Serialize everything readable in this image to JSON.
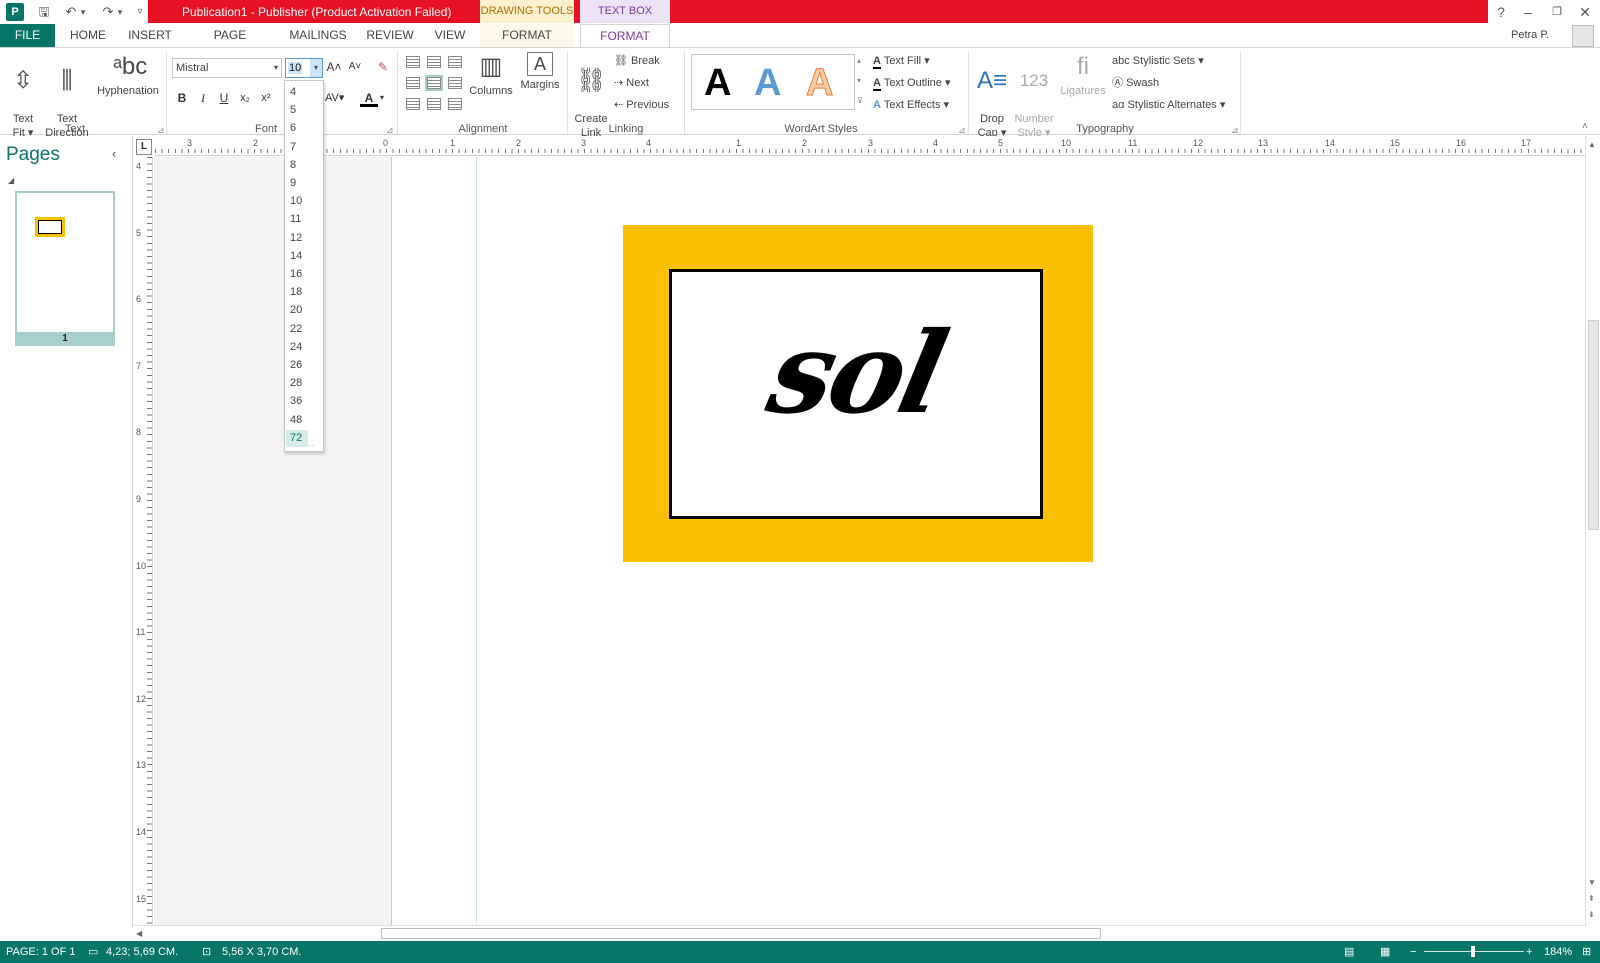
{
  "window": {
    "title": "Publication1 -  Publisher (Product Activation Failed)",
    "context_tabs": {
      "drawing": "DRAWING TOOLS",
      "textbox": "TEXT BOX TOOLS"
    },
    "help": "?",
    "minimize": "–",
    "restore": "❐",
    "close": "✕",
    "user": "Petra P.",
    "accent": "#077568",
    "titlebar_color": "#e81123"
  },
  "qat": {
    "logo": "P",
    "save": "🖫",
    "undo": "↶",
    "undo_drop": "▾",
    "redo": "↷",
    "redo_drop": "▾",
    "customize": "▿"
  },
  "tabs": {
    "file": "FILE",
    "home": "HOME",
    "insert": "INSERT",
    "page_design": "PAGE DESIGN",
    "mailings": "MAILINGS",
    "review": "REVIEW",
    "view": "VIEW",
    "format_drawing": "FORMAT",
    "format_textbox": "FORMAT"
  },
  "ribbon": {
    "text_group": {
      "label": "Text",
      "text_fit": "Text\nFit ▾",
      "text_direction": "Text\nDirection",
      "hyphenation": "Hyphenation"
    },
    "font_group": {
      "label": "Font",
      "font_name": "Mistral",
      "font_size": "10",
      "bold": "B",
      "italic": "I",
      "underline": "U",
      "subscript": "x₂",
      "superscript": "x²",
      "grow": "A˄",
      "shrink": "A˅",
      "clear": "✎",
      "font_color": "A"
    },
    "alignment_group": {
      "label": "Alignment",
      "columns": "Columns",
      "margins": "Margins"
    },
    "linking_group": {
      "label": "Linking",
      "create_link": "Create\nLink",
      "break": "Break",
      "next": "Next",
      "previous": "Previous"
    },
    "wordart_group": {
      "label": "WordArt Styles",
      "text_fill": "Text Fill ▾",
      "text_outline": "Text Outline ▾",
      "text_effects": "Text Effects ▾",
      "samples": [
        "A",
        "A",
        "A"
      ]
    },
    "typography_group": {
      "label": "Typography",
      "drop_cap": "Drop\nCap ▾",
      "number_style": "Number\nStyle ▾",
      "ligatures": "Ligatures",
      "stylistic_sets": "Stylistic Sets ▾",
      "swash": "Swash",
      "stylistic_alternates": "Stylistic Alternates ▾"
    }
  },
  "font_size_list": [
    "4",
    "5",
    "6",
    "7",
    "8",
    "9",
    "10",
    "11",
    "12",
    "14",
    "16",
    "18",
    "20",
    "22",
    "24",
    "26",
    "28",
    "36",
    "48",
    "72"
  ],
  "font_size_highlighted": "72",
  "pages_pane": {
    "title": "Pages",
    "collapse": "‹",
    "page_number": "1"
  },
  "ruler": {
    "corner": "L",
    "h_numbers": [
      "3",
      "2",
      "1",
      "0",
      "1",
      "2",
      "3",
      "4",
      "1",
      "2",
      "3",
      "4",
      "5",
      "10",
      "11",
      "12",
      "13",
      "14",
      "15",
      "16",
      "17"
    ],
    "v_numbers": [
      "4",
      "5",
      "6",
      "7",
      "8",
      "9",
      "10",
      "11",
      "12",
      "13",
      "14",
      "15"
    ]
  },
  "document": {
    "text": "sol",
    "card_color": "#fbc000"
  },
  "status": {
    "page": "PAGE: 1 OF 1",
    "position": "4,23; 5,69 CM.",
    "size": "5,56 X  3,70 CM.",
    "zoom": "184%"
  }
}
